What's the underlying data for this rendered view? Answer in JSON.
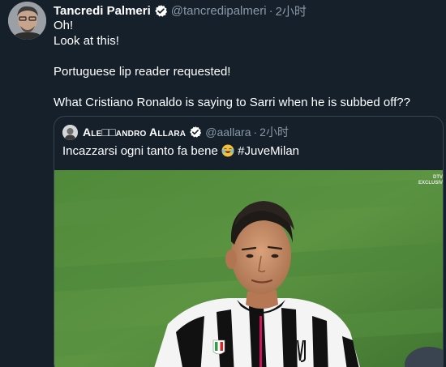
{
  "tweet": {
    "display_name": "Tancredi Palmeri",
    "handle": "@tancredipalmeri",
    "separator": "·",
    "time": "2小时",
    "lines": [
      "Oh!",
      "Look at this!",
      "",
      "Portuguese lip reader requested!",
      "",
      "What Cristiano Ronaldo is saying to Sarri when he is subbed off??"
    ]
  },
  "quoted_tweet": {
    "display_name": "Ale□□andro Allara",
    "handle": "@aallara",
    "separator": "·",
    "time": "2小时",
    "text": "Incazzarsi ogni tanto fa bene",
    "emoji": "laughing-tears-emoji",
    "hashtag": "#JuveMilan",
    "media_watermark": [
      "DTV",
      "EXCLUSIV"
    ]
  },
  "icons": {
    "verified": "verified-badge-icon"
  },
  "colors": {
    "background": "#15202b",
    "secondary_text": "#8899a6",
    "verified_blue": "#1da1f2",
    "border": "#38444d"
  }
}
